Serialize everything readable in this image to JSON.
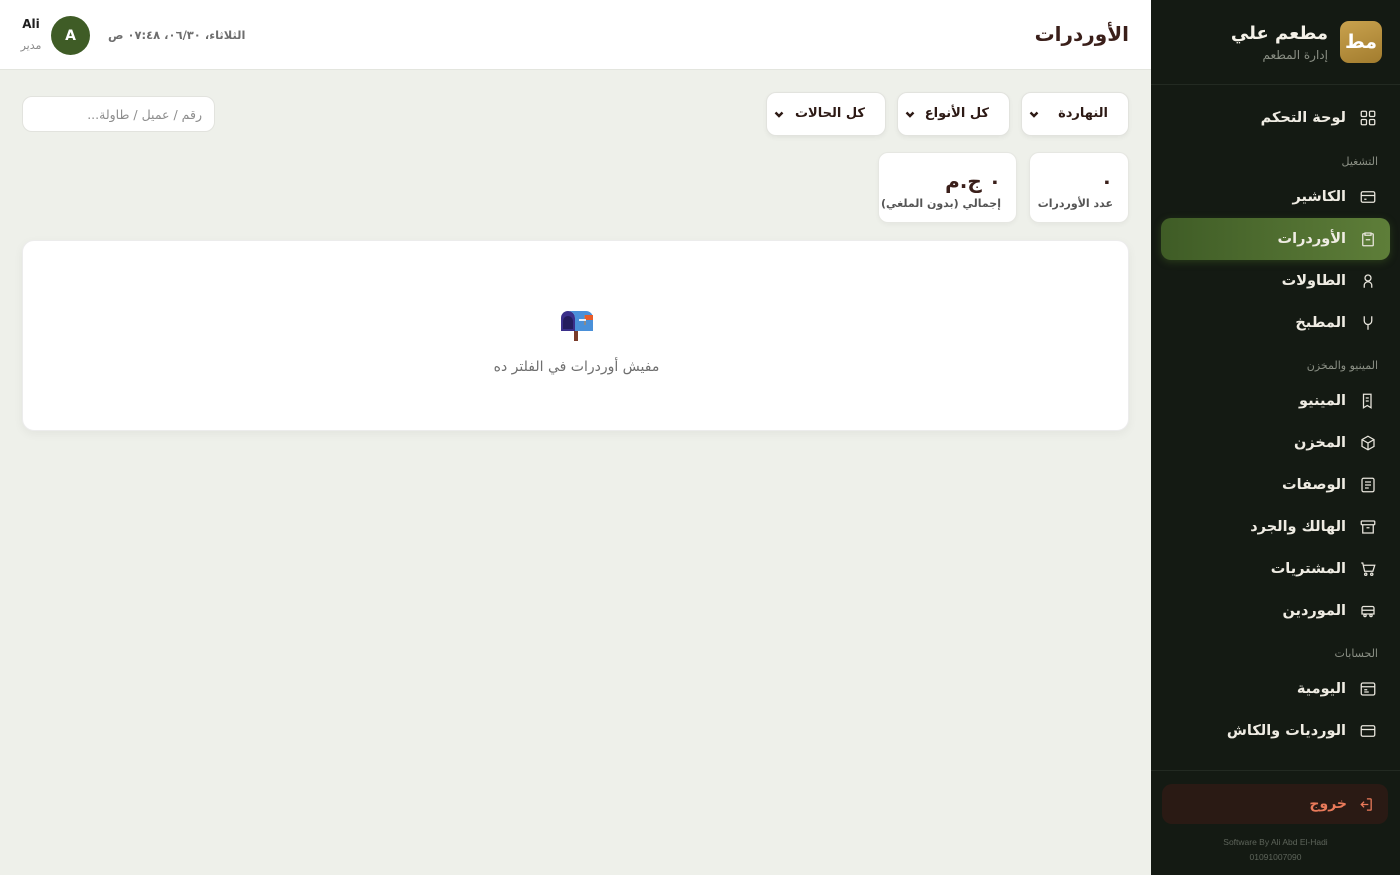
{
  "sidebar": {
    "brand": {
      "logo_text": "مط",
      "name": "مطعم علي",
      "subtitle": "إدارة المطعم"
    },
    "sections": {
      "operation": "التشغيل",
      "menu_stock": "المينيو والمخزن",
      "accounts": "الحسابات"
    },
    "items": [
      {
        "label": "لوحة التحكم",
        "icon": "dashboard-icon"
      },
      {
        "label": "الكاشير",
        "icon": "cashier-icon"
      },
      {
        "label": "الأوردرات",
        "icon": "orders-icon",
        "active": true
      },
      {
        "label": "الطاولات",
        "icon": "tables-icon"
      },
      {
        "label": "المطبخ",
        "icon": "kitchen-icon"
      },
      {
        "label": "المينيو",
        "icon": "menu-icon"
      },
      {
        "label": "المخزن",
        "icon": "box-icon"
      },
      {
        "label": "الوصفات",
        "icon": "recipes-icon"
      },
      {
        "label": "الهالك والجرد",
        "icon": "archive-icon"
      },
      {
        "label": "المشتريات",
        "icon": "cart-icon"
      },
      {
        "label": "الموردين",
        "icon": "truck-icon"
      },
      {
        "label": "اليومية",
        "icon": "journal-icon"
      },
      {
        "label": "الورديات والكاش",
        "icon": "card-icon"
      }
    ],
    "logout_label": "خروج",
    "credit_line1": "Software By Ali Abd El-Hadi",
    "credit_line2": "01091007090"
  },
  "header": {
    "title": "الأوردرات",
    "datetime": "الثلاثاء، ٠٦/٣٠، ٠٧:٤٨ ص",
    "user": {
      "initial": "A",
      "name": "Ali",
      "role": "مدير"
    }
  },
  "filters": {
    "period": "النهاردة",
    "type": "كل الأنواع",
    "status": "كل الحالات",
    "search_placeholder": "رقم / عميل / طاولة..."
  },
  "stats": {
    "orders_count_value": "٠",
    "orders_count_label": "عدد الأوردرات",
    "total_value": "٠ ج.م",
    "total_label": "إجمالي (بدون الملغي)"
  },
  "empty_state": {
    "icon": "mailbox-icon",
    "message": "مفيش أوردرات في الفلتر ده"
  },
  "colors": {
    "sidebar_bg": "#141a13",
    "accent_green": "#4f6e30",
    "brand_gold": "#b98f3e",
    "logout_red": "#e97a5a"
  }
}
